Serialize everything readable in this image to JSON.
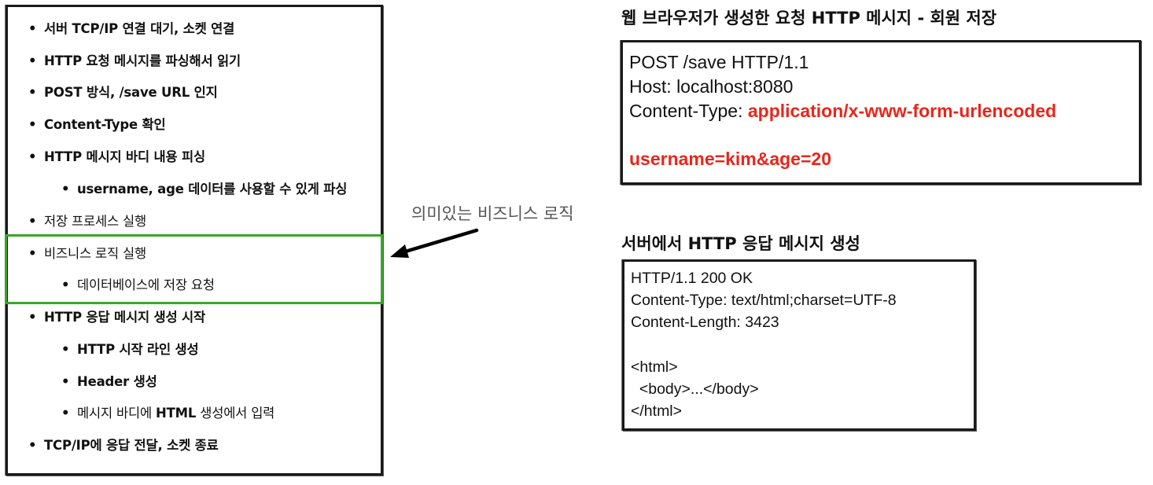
{
  "steps": [
    {
      "level": 1,
      "text": "서버 TCP/IP 연결 대기, 소켓 연결"
    },
    {
      "level": 1,
      "text": "HTTP 요청 메시지를 파싱해서 읽기"
    },
    {
      "level": 1,
      "text": "POST 방식, /save URL 인지"
    },
    {
      "level": 1,
      "text": "Content-Type 확인"
    },
    {
      "level": 1,
      "text": "HTTP 메시지 바디 내용 피싱"
    },
    {
      "level": 2,
      "text": "username, age 데이터를 사용할 수 있게 파싱"
    },
    {
      "level": 1,
      "text": "저장 프로세스 실행"
    },
    {
      "level": 1,
      "text": "비즈니스 로직 실행"
    },
    {
      "level": 2,
      "text": "데이터베이스에 저장 요청"
    },
    {
      "level": 1,
      "text": "HTTP 응답 메시지 생성 시작"
    },
    {
      "level": 2,
      "text": "HTTP 시작 라인 생성"
    },
    {
      "level": 2,
      "text": "Header 생성"
    },
    {
      "level": 2,
      "text_before": "메시지 바디에 ",
      "text_bold": "HTML",
      "text_after": " 생성에서 입력"
    },
    {
      "level": 1,
      "text": "TCP/IP에 응답 전달, 소켓 종료"
    }
  ],
  "bullet": "•",
  "arrow_label": "의미있는 비즈니스 로직",
  "request": {
    "title": "웹 브라우저가 생성한 요청 HTTP 메시지 - 회원 저장",
    "line1": "POST /save HTTP/1.1",
    "line2": "Host: localhost:8080",
    "line3_label": "Content-Type: ",
    "line3_value": "application/x-www-form-urlencoded",
    "body": "username=kim&age=20"
  },
  "response": {
    "title_before": "서버에서 ",
    "title_bold": "HTTP",
    "title_after": " 응답 메시지 생성",
    "lines": [
      "HTTP/1.1 200 OK",
      "Content-Type: text/html;charset=UTF-8",
      "Content-Length: 3423",
      "<html>",
      "  <body>...</body>",
      "</html>"
    ]
  },
  "colors": {
    "highlight": "#3aa62a",
    "accent_red": "#e8261c",
    "label_gray": "#555555",
    "border": "#1a1a1a"
  }
}
